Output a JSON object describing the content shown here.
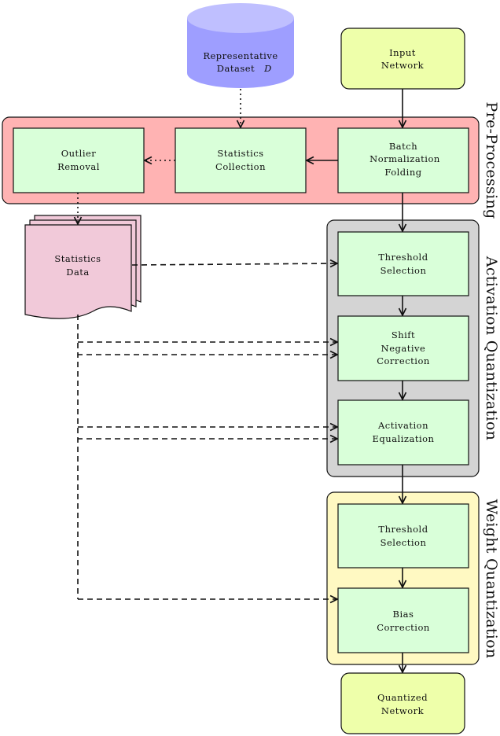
{
  "colors": {
    "preprocessing_group": "#ffb3b3",
    "activation_group": "#d4d4d4",
    "weight_group": "#fff9c2",
    "step_box": "#d9ffd9",
    "network_box": "#eeffaa",
    "dataset_top": "#bfbfff",
    "dataset_body": "#9e9eff",
    "statistics_doc": "#f1c9d9"
  },
  "dataset": {
    "line1": "Representative",
    "line2": "Dataset",
    "symbol": "D"
  },
  "input_network": {
    "line1": "Input",
    "line2": "Network"
  },
  "quantized_network": {
    "line1": "Quantized",
    "line2": "Network"
  },
  "groups": {
    "preprocessing": "Pre-Processing",
    "activation": "Activation Quantization",
    "weight": "Weight Quantization"
  },
  "preprocessing_steps": {
    "outlier": [
      "Outlier",
      "Removal"
    ],
    "stats": [
      "Statistics",
      "Collection"
    ],
    "bn": [
      "Batch",
      "Normalization",
      "Folding"
    ]
  },
  "statistics_data": [
    "Statistics",
    "Data"
  ],
  "activation_steps": {
    "threshold": [
      "Threshold",
      "Selection"
    ],
    "snc": [
      "Shift",
      "Negative",
      "Correction"
    ],
    "eq": [
      "Activation",
      "Equalization"
    ]
  },
  "weight_steps": {
    "threshold": [
      "Threshold",
      "Selection"
    ],
    "bias": [
      "Bias",
      "Correction"
    ]
  }
}
